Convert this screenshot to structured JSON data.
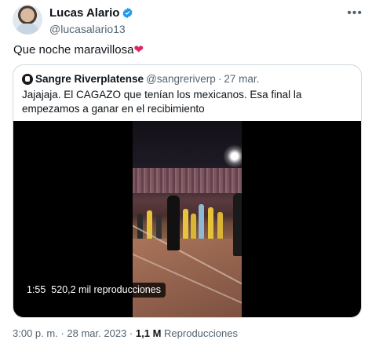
{
  "author": {
    "display_name": "Lucas Alario",
    "handle": "@lucasalario13"
  },
  "tweet": {
    "text": "Que noche maravillosa",
    "emoji": "❤"
  },
  "quoted": {
    "display_name": "Sangre Riverplatense",
    "handle": "@sangreriverp",
    "separator": "·",
    "date": "27 mar.",
    "text": "Jajajaja. El CAGAZO que tenían los mexicanos. Esa final la empezamos a ganar en el recibimiento",
    "video": {
      "duration": "1:55",
      "views": "520,2 mil reproducciones"
    }
  },
  "footer": {
    "time": "3:00 p. m.",
    "separator1": "·",
    "date": "28 mar. 2023",
    "separator2": "·",
    "views_count": "1,1 M",
    "views_label": "Reproducciones"
  },
  "icons": {
    "verified": "verified-badge-icon",
    "more": "more-options-icon"
  },
  "colors": {
    "verified": "#1d9bf0",
    "secondary_text": "#536471",
    "border": "#cfd9de",
    "heart": "#e0245e"
  }
}
